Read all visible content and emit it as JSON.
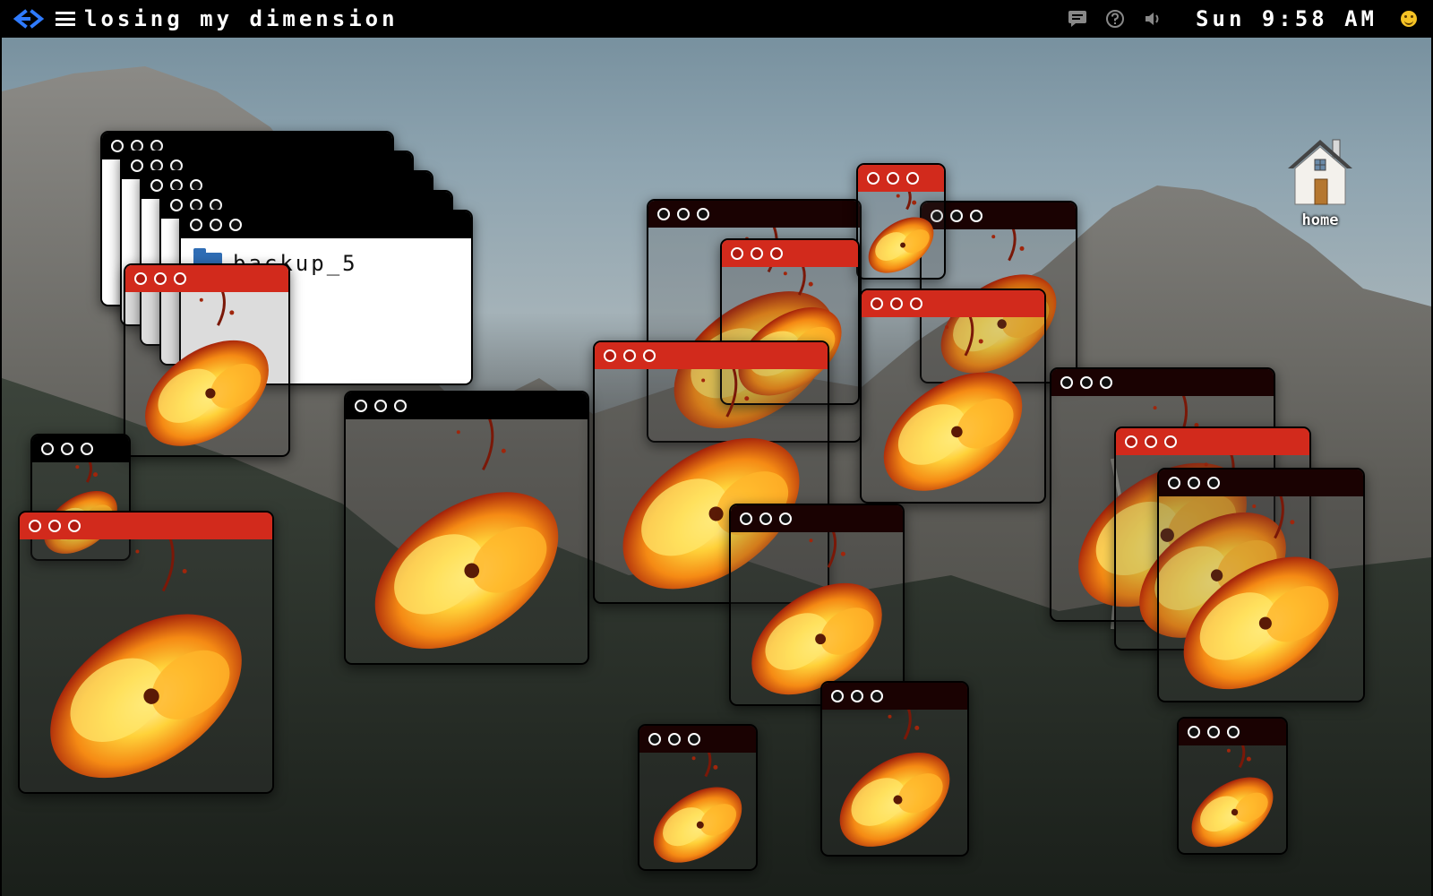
{
  "menubar": {
    "title": "losing my dimension",
    "clock": "Sun 9:58 AM",
    "icons": [
      "back-icon",
      "menu-icon",
      "chat-icon",
      "help-icon",
      "volume-icon",
      "smiley-icon"
    ]
  },
  "desktop": {
    "home_icon": {
      "label": "home",
      "icon": "house-icon"
    },
    "backup_window": {
      "folder_name": "backup_5",
      "icon": "folder-icon"
    }
  },
  "colors": {
    "titlebar_red": "#d22a1c",
    "titlebar_dark": "#1a0202",
    "titlebar_black": "#000000",
    "back_arrow": "#2f7bff"
  }
}
